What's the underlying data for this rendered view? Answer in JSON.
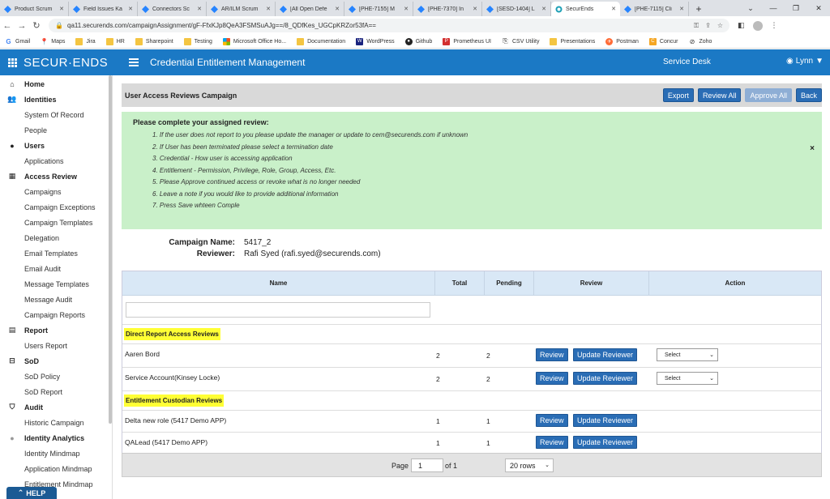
{
  "browser": {
    "tabs": [
      {
        "label": "Product Scrum"
      },
      {
        "label": "Field Issues Ka"
      },
      {
        "label": "Connectors Sc"
      },
      {
        "label": "AR/ILM Scrum"
      },
      {
        "label": "[All Open Defe"
      },
      {
        "label": "[PHE-7155] M"
      },
      {
        "label": "[PHE-7370] In"
      },
      {
        "label": "[SESD-1404] L"
      },
      {
        "label": "SecurEnds",
        "active": true
      },
      {
        "label": "[PHE-7115] Cli"
      }
    ],
    "url": "qa11.securends.com/campaignAssignment/gF-FfxKJp8QeA3FSMSuAJg==/8_QDfKes_UGCpKRZor53fA==",
    "bookmarks": [
      {
        "label": "Gmail",
        "icon": "gmail-icon"
      },
      {
        "label": "Maps",
        "icon": "maps-icon"
      },
      {
        "label": "Jira",
        "icon": "folder-icon"
      },
      {
        "label": "HR",
        "icon": "folder-icon"
      },
      {
        "label": "Sharepoint",
        "icon": "folder-icon"
      },
      {
        "label": "Testing",
        "icon": "folder-icon"
      },
      {
        "label": "Microsoft Office Ho...",
        "icon": "office-icon"
      },
      {
        "label": "Documentation",
        "icon": "folder-icon"
      },
      {
        "label": "WordPress",
        "icon": "wordpress-icon"
      },
      {
        "label": "Github",
        "icon": "github-icon"
      },
      {
        "label": "Prometheus UI",
        "icon": "prometheus-icon"
      },
      {
        "label": "CSV Utility",
        "icon": "csv-icon"
      },
      {
        "label": "Presentations",
        "icon": "folder-icon"
      },
      {
        "label": "Postman",
        "icon": "postman-icon"
      },
      {
        "label": "Concur",
        "icon": "concur-icon"
      },
      {
        "label": "Zoho",
        "icon": "zoho-icon"
      }
    ]
  },
  "header": {
    "logo": "SECUR·ENDS",
    "title": "Credential Entitlement Management",
    "service_desk": "Service Desk",
    "user": "Lynn"
  },
  "sidebar": {
    "items": [
      {
        "label": "Home",
        "type": "sect",
        "icon": "home-icon"
      },
      {
        "label": "Identities",
        "type": "sect",
        "icon": "users-icon"
      },
      {
        "label": "System Of Record",
        "type": "sub"
      },
      {
        "label": "People",
        "type": "sub"
      },
      {
        "label": "Users",
        "type": "sect",
        "icon": "user-icon"
      },
      {
        "label": "Applications",
        "type": "sub"
      },
      {
        "label": "Access Review",
        "type": "sect",
        "icon": "grid-icon"
      },
      {
        "label": "Campaigns",
        "type": "sub"
      },
      {
        "label": "Campaign Exceptions",
        "type": "sub"
      },
      {
        "label": "Campaign Templates",
        "type": "sub"
      },
      {
        "label": "Delegation",
        "type": "sub"
      },
      {
        "label": "Email Templates",
        "type": "sub"
      },
      {
        "label": "Email Audit",
        "type": "sub"
      },
      {
        "label": "Message Templates",
        "type": "sub"
      },
      {
        "label": "Message Audit",
        "type": "sub"
      },
      {
        "label": "Campaign Reports",
        "type": "sub"
      },
      {
        "label": "Report",
        "type": "sect",
        "icon": "report-icon"
      },
      {
        "label": "Users Report",
        "type": "sub"
      },
      {
        "label": "SoD",
        "type": "sect",
        "icon": "sod-icon"
      },
      {
        "label": "SoD Policy",
        "type": "sub"
      },
      {
        "label": "SoD Report",
        "type": "sub"
      },
      {
        "label": "Audit",
        "type": "sect",
        "icon": "shield-icon"
      },
      {
        "label": "Historic Campaign",
        "type": "sub"
      },
      {
        "label": "Identity Analytics",
        "type": "sect",
        "icon": "analytics-icon"
      },
      {
        "label": "Identity Mindmap",
        "type": "sub"
      },
      {
        "label": "Application Mindmap",
        "type": "sub"
      },
      {
        "label": "Entitlement Mindmap",
        "type": "sub"
      }
    ],
    "help": "HELP"
  },
  "campaign": {
    "title": "User Access Reviews Campaign",
    "buttons": {
      "export": "Export",
      "review_all": "Review All",
      "approve_all": "Approve All",
      "back": "Back"
    },
    "notice_heading": "Please complete your assigned review:",
    "notice_items": [
      "1. If the user does not report to you please update the manager or update to cem@securends.com if unknown",
      "2. If User has been terminated please select a termination date",
      "3. Credential - How user is accessing application",
      "4. Entitlement - Permission, Privilege, Role, Group, Access, Etc.",
      "5. Please Approve continued access or revoke what is no longer needed",
      "6. Leave a note if you would like to provide additional information",
      "7. Press Save whteen Comple"
    ],
    "notice_close": "×",
    "name_label": "Campaign Name:",
    "name_value": "5417_2",
    "reviewer_label": "Reviewer:",
    "reviewer_value": "Rafi Syed (rafi.syed@securends.com)"
  },
  "table": {
    "headers": {
      "name": "Name",
      "total": "Total",
      "pending": "Pending",
      "review": "Review",
      "action": "Action"
    },
    "groups": [
      {
        "label": "Direct Report Access Reviews",
        "rows": [
          {
            "name": "Aaren Bord",
            "total": "2",
            "pending": "2",
            "review": "Review",
            "update": "Update Reviewer",
            "select": "Select"
          },
          {
            "name": "Service Account(Kinsey Locke)",
            "total": "2",
            "pending": "2",
            "review": "Review",
            "update": "Update Reviewer",
            "select": "Select"
          }
        ]
      },
      {
        "label": "Entitlement Custodian Reviews",
        "rows": [
          {
            "name": "Delta new role (5417 Demo APP)",
            "total": "1",
            "pending": "1",
            "review": "Review",
            "update": "Update Reviewer"
          },
          {
            "name": "QALead (5417 Demo APP)",
            "total": "1",
            "pending": "1",
            "review": "Review",
            "update": "Update Reviewer"
          }
        ]
      }
    ]
  },
  "pager": {
    "page_label": "Page",
    "page": "1",
    "of_label": "of 1",
    "rows": "20 rows"
  },
  "colors": {
    "brand_blue": "#1b79c5",
    "button_blue": "#2a6db5",
    "notice_green": "#c9f0c9",
    "highlight_yellow": "#ffff35"
  }
}
